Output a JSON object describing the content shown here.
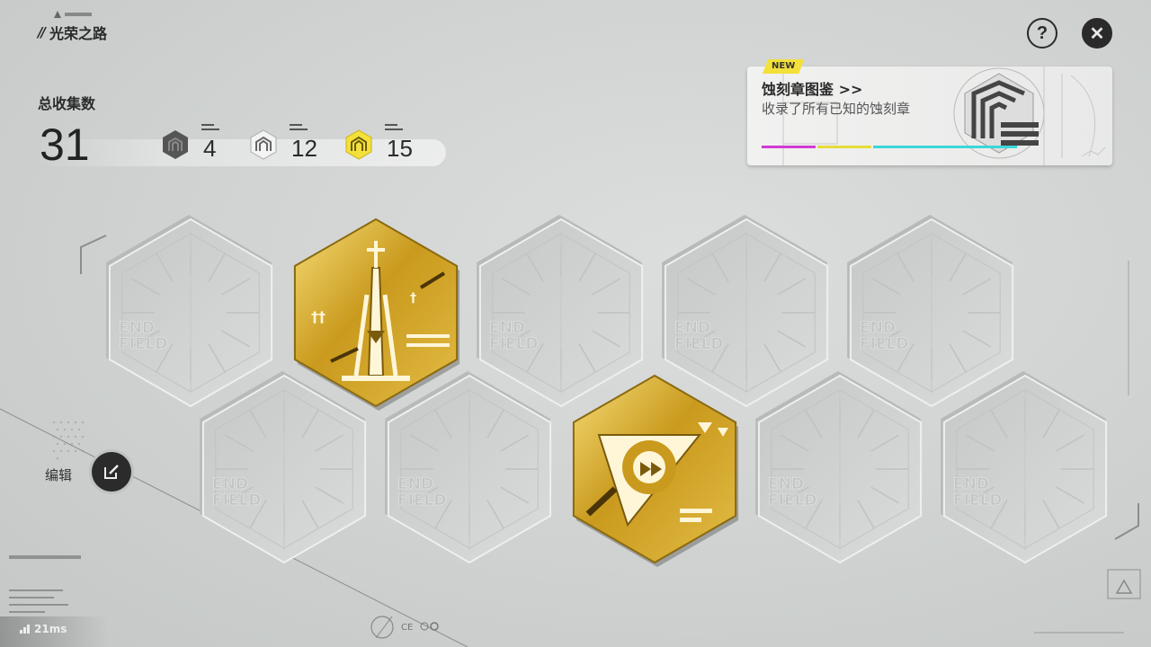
{
  "header": {
    "title": "光荣之路"
  },
  "stats": {
    "label": "总收集数",
    "total": "31",
    "badges": [
      {
        "icon": "dark-badge-icon",
        "count": "4",
        "color": "#5a5a5a"
      },
      {
        "icon": "silver-badge-icon",
        "count": "12",
        "color": "#f2f2f2"
      },
      {
        "icon": "gold-badge-icon",
        "count": "15",
        "color": "#f3e03a"
      }
    ]
  },
  "toolbar": {
    "help_label": "?",
    "close_label": "✕"
  },
  "catalog": {
    "new_tag": "NEW",
    "title": "蚀刻章图鉴 >>",
    "description": "收录了所有已知的蚀刻章",
    "strip_colors": [
      "#d23ad6",
      "#e6dc3a",
      "#3cd6d8",
      "#f0f0f0"
    ]
  },
  "edit": {
    "label": "编辑"
  },
  "footer": {
    "ping": "21ms"
  },
  "colors": {
    "gold": "#c99a1d",
    "gold_light": "#f3d66a",
    "slot_face": "#d2d4d3"
  },
  "slots": {
    "empty_logo_line1": "END",
    "empty_logo_line2": "FIELD",
    "items": [
      {
        "row": 0,
        "col": 0,
        "state": "empty"
      },
      {
        "row": 0,
        "col": 1,
        "state": "filled",
        "medal": "tower-medal-icon"
      },
      {
        "row": 0,
        "col": 2,
        "state": "empty"
      },
      {
        "row": 0,
        "col": 3,
        "state": "empty"
      },
      {
        "row": 0,
        "col": 4,
        "state": "empty"
      },
      {
        "row": 1,
        "col": 0,
        "state": "empty"
      },
      {
        "row": 1,
        "col": 1,
        "state": "empty"
      },
      {
        "row": 1,
        "col": 2,
        "state": "filled",
        "medal": "arrow-medal-icon"
      },
      {
        "row": 1,
        "col": 3,
        "state": "empty"
      },
      {
        "row": 1,
        "col": 4,
        "state": "empty"
      }
    ]
  }
}
